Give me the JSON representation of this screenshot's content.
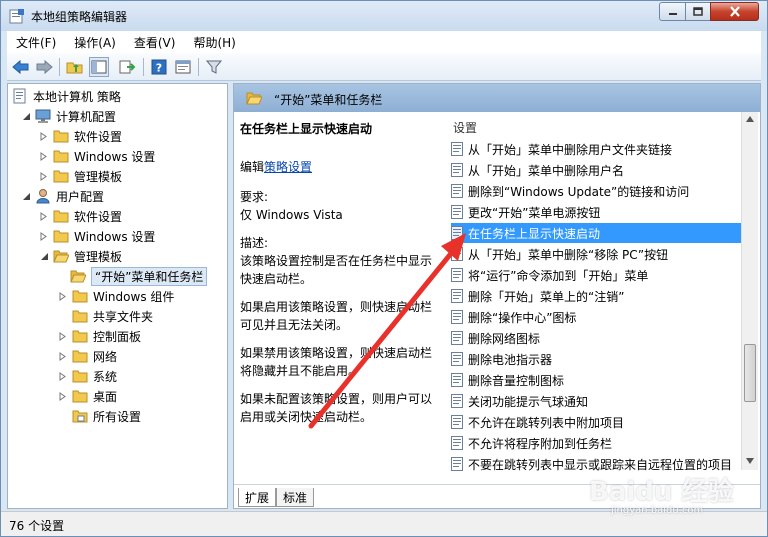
{
  "window": {
    "title": "本地组策略编辑器",
    "min_icon": "minimize-icon",
    "max_icon": "maximize-icon",
    "close_icon": "close-icon"
  },
  "menubar": {
    "items": [
      "文件(F)",
      "操作(A)",
      "查看(V)",
      "帮助(H)"
    ]
  },
  "toolbar": {
    "icons": [
      "back-arrow-icon",
      "forward-arrow-icon",
      "up-folder-icon",
      "show-hide-tree-icon",
      "export-list-icon",
      "help-icon",
      "properties-icon",
      "filter-icon"
    ]
  },
  "tree": {
    "root": "本地计算机 策略",
    "computer_config": "计算机配置",
    "computer_children": [
      "软件设置",
      "Windows 设置",
      "管理模板"
    ],
    "user_config": "用户配置",
    "user_children": [
      "软件设置",
      "Windows 设置",
      "管理模板"
    ],
    "templates_children": [
      "“开始”菜单和任务栏",
      "Windows 组件",
      "共享文件夹",
      "控制面板",
      "网络",
      "系统",
      "桌面",
      "所有设置"
    ]
  },
  "content": {
    "header_title": "“开始”菜单和任务栏",
    "desc_title": "在任务栏上显示快速启动",
    "edit_prefix": "编辑",
    "edit_link": "策略设置",
    "req_label": "要求:",
    "req_value": "仅 Windows Vista",
    "desc_label": "描述:",
    "desc_text": "该策略设置控制是否在任务栏中显示快速启动栏。",
    "enabled_text": "如果启用该策略设置，则快速启动栏可见并且无法关闭。",
    "disabled_text": "如果禁用该策略设置，则快速启动栏将隐藏并且不能启用。",
    "notconfig_text": "如果未配置该策略设置，则用户可以启用或关闭快速启动栏。",
    "settings_header": "设置",
    "settings": [
      "从「开始」菜单中删除用户文件夹链接",
      "从「开始」菜单中删除用户名",
      "删除到“Windows Update”的链接和访问",
      "更改“开始”菜单电源按钮",
      "在任务栏上显示快速启动",
      "从「开始」菜单中删除“移除 PC”按钮",
      "将“运行”命令添加到「开始」菜单",
      "删除「开始」菜单上的“注销”",
      "删除“操作中心”图标",
      "删除网络图标",
      "删除电池指示器",
      "删除音量控制图标",
      "关闭功能提示气球通知",
      "不允许在跳转列表中附加项目",
      "不允许将程序附加到任务栏",
      "不要在跳转列表中显示或跟踪来自远程位置的项目"
    ],
    "selected_index": 4,
    "tabs": [
      "扩展",
      "标准"
    ]
  },
  "status": {
    "text": "76 个设置"
  },
  "watermark": {
    "brand": "Baidu 经验",
    "sub": "jingyan.baidu.com"
  },
  "colors": {
    "accent": "#3399ff",
    "header_bg": "#9dbbdc",
    "arrow": "#e8312a",
    "folder": "#f2c94c"
  }
}
